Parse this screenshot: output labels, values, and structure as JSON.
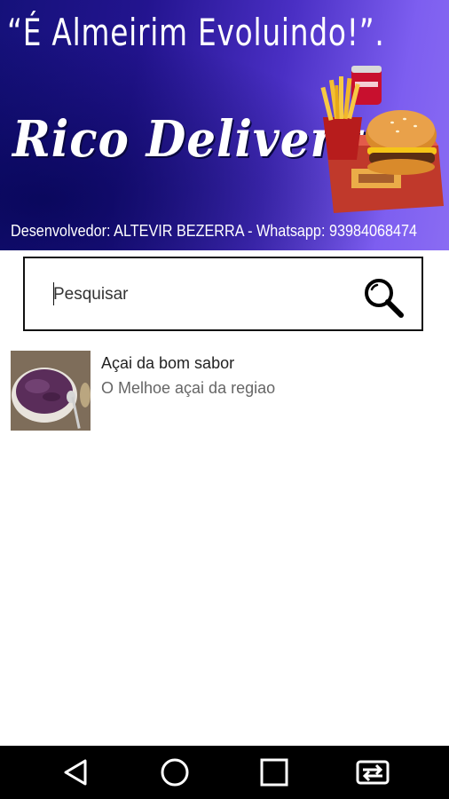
{
  "banner": {
    "slogan": "“É Almeirim Evoluindo!”.",
    "brand": "Rico Delivery",
    "developer_line": "Desenvolvedor: ALTEVIR BEZERRA - Whatsapp: 93984068474"
  },
  "search": {
    "placeholder": "Pesquisar",
    "value": "",
    "icon": "search-icon"
  },
  "list": {
    "items": [
      {
        "title": "Açai da bom sabor",
        "subtitle": "O Melhoe açai da regiao",
        "thumbnail": "acai-bowl-image"
      }
    ]
  },
  "navbar": {
    "buttons": [
      "back-icon",
      "home-icon",
      "recents-icon",
      "switch-apps-icon"
    ]
  },
  "colors": {
    "banner_dark": "#15117a",
    "banner_light": "#8a6cf3",
    "navbar": "#000000",
    "subtitle": "#666666"
  }
}
